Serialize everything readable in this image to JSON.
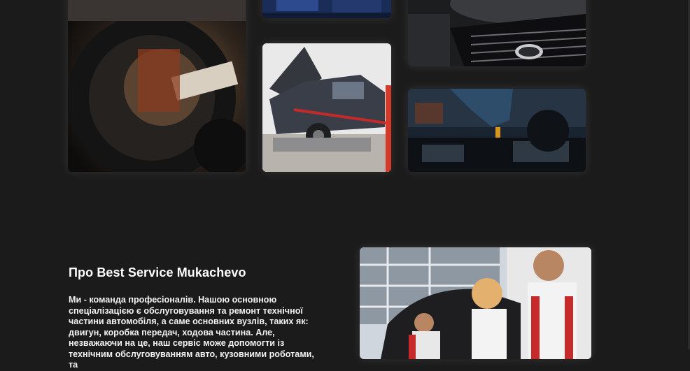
{
  "gallery": {
    "images": [
      {
        "name": "suspension-repair-photo",
        "alt": "Suspension repair"
      },
      {
        "name": "engine-top-photo",
        "alt": "Engine detail"
      },
      {
        "name": "lexus-grille-photo",
        "alt": "Lexus grille"
      },
      {
        "name": "body-straightening-photo",
        "alt": "Body repair on stand"
      },
      {
        "name": "oil-change-photo",
        "alt": "Oil change"
      },
      {
        "name": "mechanics-team-photo",
        "alt": "Mechanics with client"
      }
    ]
  },
  "about": {
    "title": "Про Best Service Mukachevo",
    "text": "Ми - команда професіоналів. Нашою основною спеціалізацією є обслуговування та ремонт технічної частини автомобіля, а саме основних вузлів, таких як: двигун, коробка передач, ходова частина. Але, незважаючи на це, наш сервіс може допомогти із технічним обслуговуванням авто, кузовними роботами, та"
  },
  "colors": {
    "background": "#1b1b1b",
    "text": "#ffffff"
  }
}
